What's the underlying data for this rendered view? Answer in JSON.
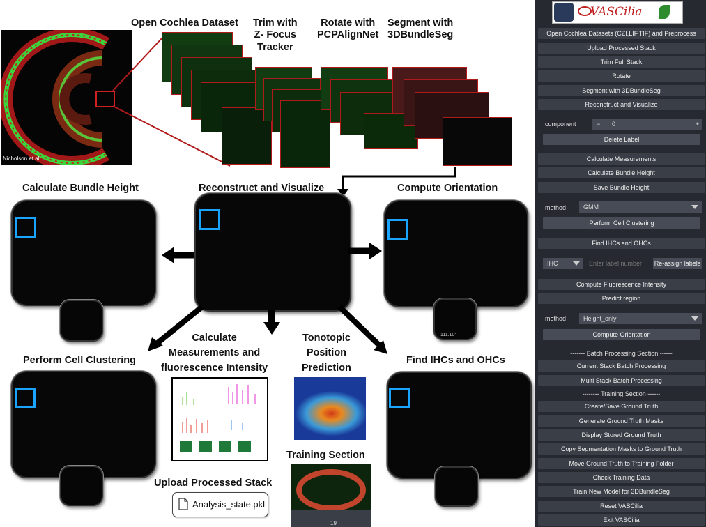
{
  "labels": {
    "open": "Open Cochlea Dataset",
    "trim": "Trim with\nZ- Focus\nTracker",
    "rotate": "Rotate with\nPCPAlignNet",
    "segment": "Segment with\n3DBundleSeg",
    "bundle_height": "Calculate Bundle Height",
    "reconstruct": "Reconstruct and Visualize",
    "orientation": "Compute Orientation",
    "clustering": "Perform Cell Clustering",
    "measurements": "Calculate\nMeasurements and\nfluorescence Intensity",
    "tonotopic": "Tonotopic\nPosition\nPrediction",
    "ihc_ohc": "Find IHCs and OHCs",
    "training": "Training Section",
    "upload": "Upload Processed Stack",
    "credit": "Nicholson et al.",
    "file_name": "Analysis_state.pkl",
    "angle": "111.10°",
    "slider_value": "19"
  },
  "panel": {
    "logo_text": "VASCilia",
    "buttons": [
      "Open Cochlea Datasets (CZI,LIF,TIF) and Preprocess",
      "Upload Processed Stack",
      "Trim Full Stack",
      "Rotate",
      "Segment with 3DBundleSeg",
      "Reconstruct and Visualize"
    ],
    "component_label": "component",
    "component_minus": "−",
    "component_value": "0",
    "component_plus": "+",
    "delete_label": "Delete Label",
    "buttons2": [
      "Calculate Measurements",
      "Calculate Bundle Height",
      "Save Bundle Height"
    ],
    "method_label": "method",
    "method1_value": "GMM",
    "cluster_button": "Perform Cell Clustering",
    "find_button": "Find IHCs and OHCs",
    "ihc_value": "IHC",
    "label_placeholder": "Enter label number",
    "reassign_button": "Re-assign labels",
    "buttons3": [
      "Compute Fluorescence Intensity",
      "Predict region"
    ],
    "method2_value": "Height_only",
    "orientation_button": "Compute Orientation",
    "batch_header": "------- Batch Processing Section ------",
    "batch_buttons": [
      "Current Stack Batch Processing",
      "Multi Stack Batch Processing"
    ],
    "training_header": "-------- Training Section ------",
    "training_buttons": [
      "Create/Save Ground Truth",
      "Generate Ground Truth Masks",
      "Display Stored Ground Truth",
      "Copy Segmentation Masks to Ground Truth",
      "Move Ground Truth to Training Folder",
      "Check Training Data",
      "Train New Model for 3DBundleSeg",
      "Reset VASCilia",
      "Exit VASCilia"
    ]
  },
  "colors": {
    "accent_blue": "#1aa3ff",
    "red_line": "#b01a1a",
    "panel_bg": "#262930",
    "button_bg": "#3a3e47"
  }
}
